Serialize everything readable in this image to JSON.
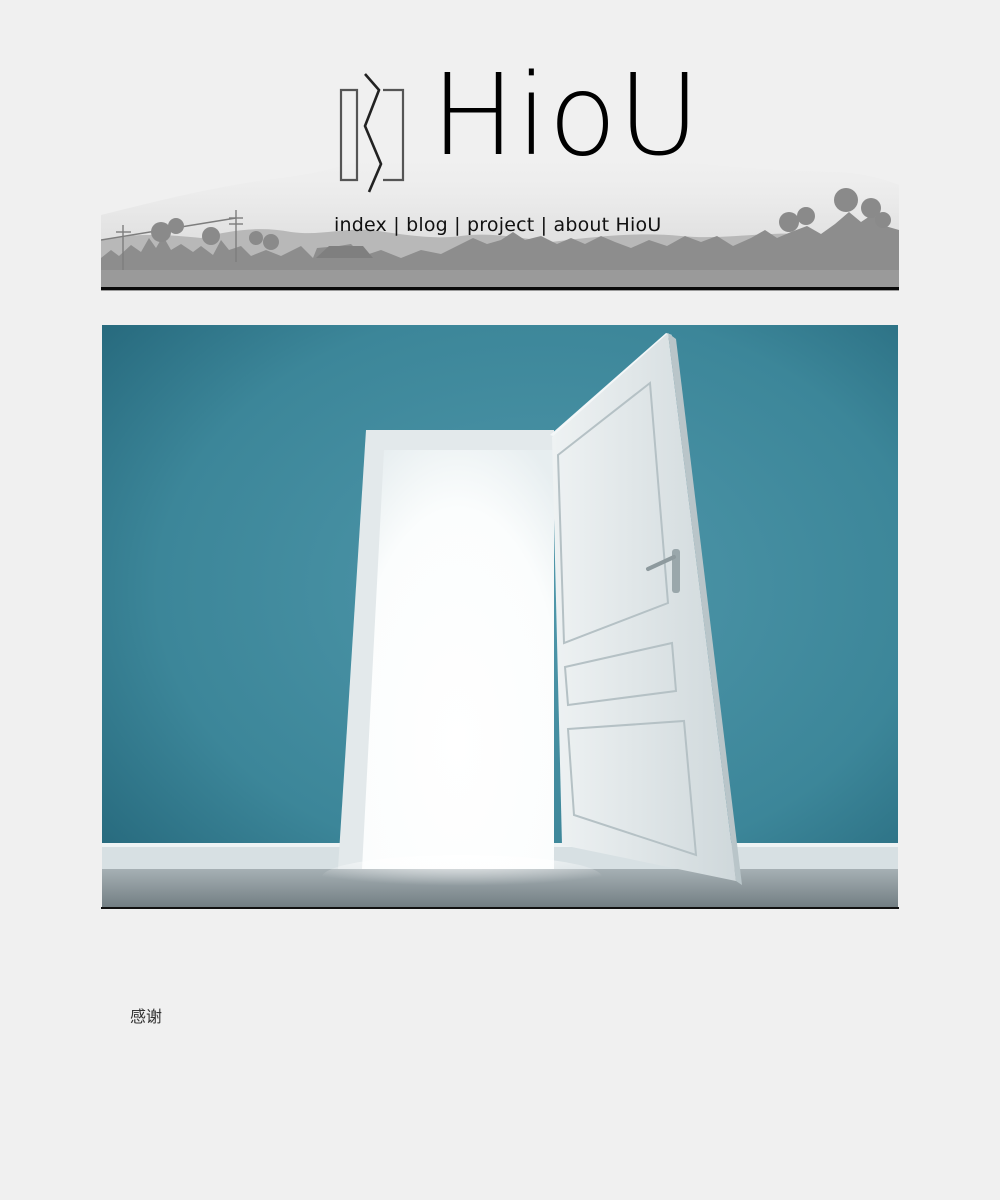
{
  "site": {
    "logo_text": "HioU"
  },
  "nav": {
    "items": [
      {
        "label": "index"
      },
      {
        "label": "blog"
      },
      {
        "label": "project"
      },
      {
        "label": "about HioU"
      }
    ],
    "separator": "|"
  },
  "hero": {
    "icon": "open-door-illustration",
    "wall_color": "#3f8ea3",
    "floor_color": "#8a9599"
  },
  "content": {
    "text": "感谢"
  },
  "colors": {
    "page_background": "#f0f0f0",
    "rule": "#0a0a0a"
  }
}
